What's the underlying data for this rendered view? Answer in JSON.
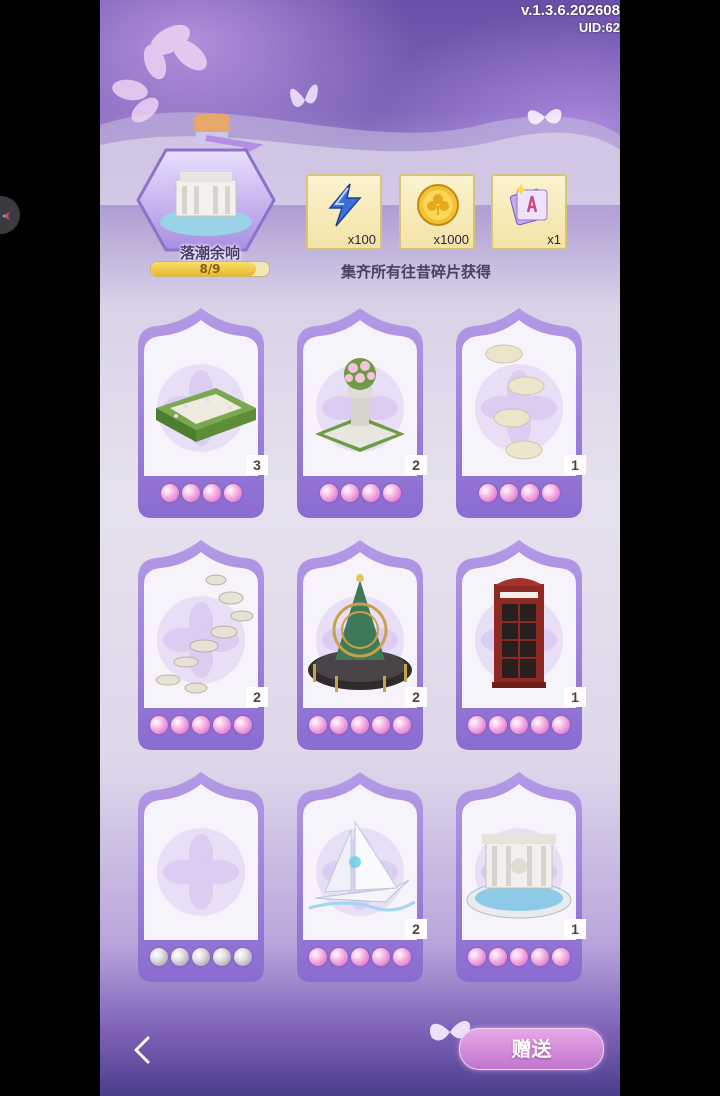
{
  "header": {
    "version": "v.1.3.6.202608",
    "uid": "UID:62"
  },
  "collection": {
    "name": "落潮余响",
    "progress_text": "8/9",
    "progress_fraction": 0.889
  },
  "rewards": [
    {
      "icon": "lightning-icon",
      "qty": "x100"
    },
    {
      "icon": "gold-coin-icon",
      "qty": "x1000"
    },
    {
      "icon": "card-pack-icon",
      "qty": "x1"
    }
  ],
  "reward_caption": "集齐所有往昔碎片获得",
  "cards": [
    {
      "item": "hedge-garden",
      "count": "3",
      "stars": 4,
      "stars_filled": 4
    },
    {
      "item": "flower-urn",
      "count": "2",
      "stars": 4,
      "stars_filled": 4
    },
    {
      "item": "stepping-stones",
      "count": "1",
      "stars": 4,
      "stars_filled": 4
    },
    {
      "item": "stone-path",
      "count": "2",
      "stars": 5,
      "stars_filled": 5
    },
    {
      "item": "armillary-carousel",
      "count": "2",
      "stars": 5,
      "stars_filled": 5
    },
    {
      "item": "phone-booth",
      "count": "1",
      "stars": 5,
      "stars_filled": 5
    },
    {
      "item": "empty-slot",
      "count": "",
      "stars": 5,
      "stars_filled": 0
    },
    {
      "item": "sailboat",
      "count": "2",
      "stars": 5,
      "stars_filled": 5
    },
    {
      "item": "fountain",
      "count": "1",
      "stars": 5,
      "stars_filled": 5
    }
  ],
  "footer": {
    "gift_label": "赠送"
  }
}
